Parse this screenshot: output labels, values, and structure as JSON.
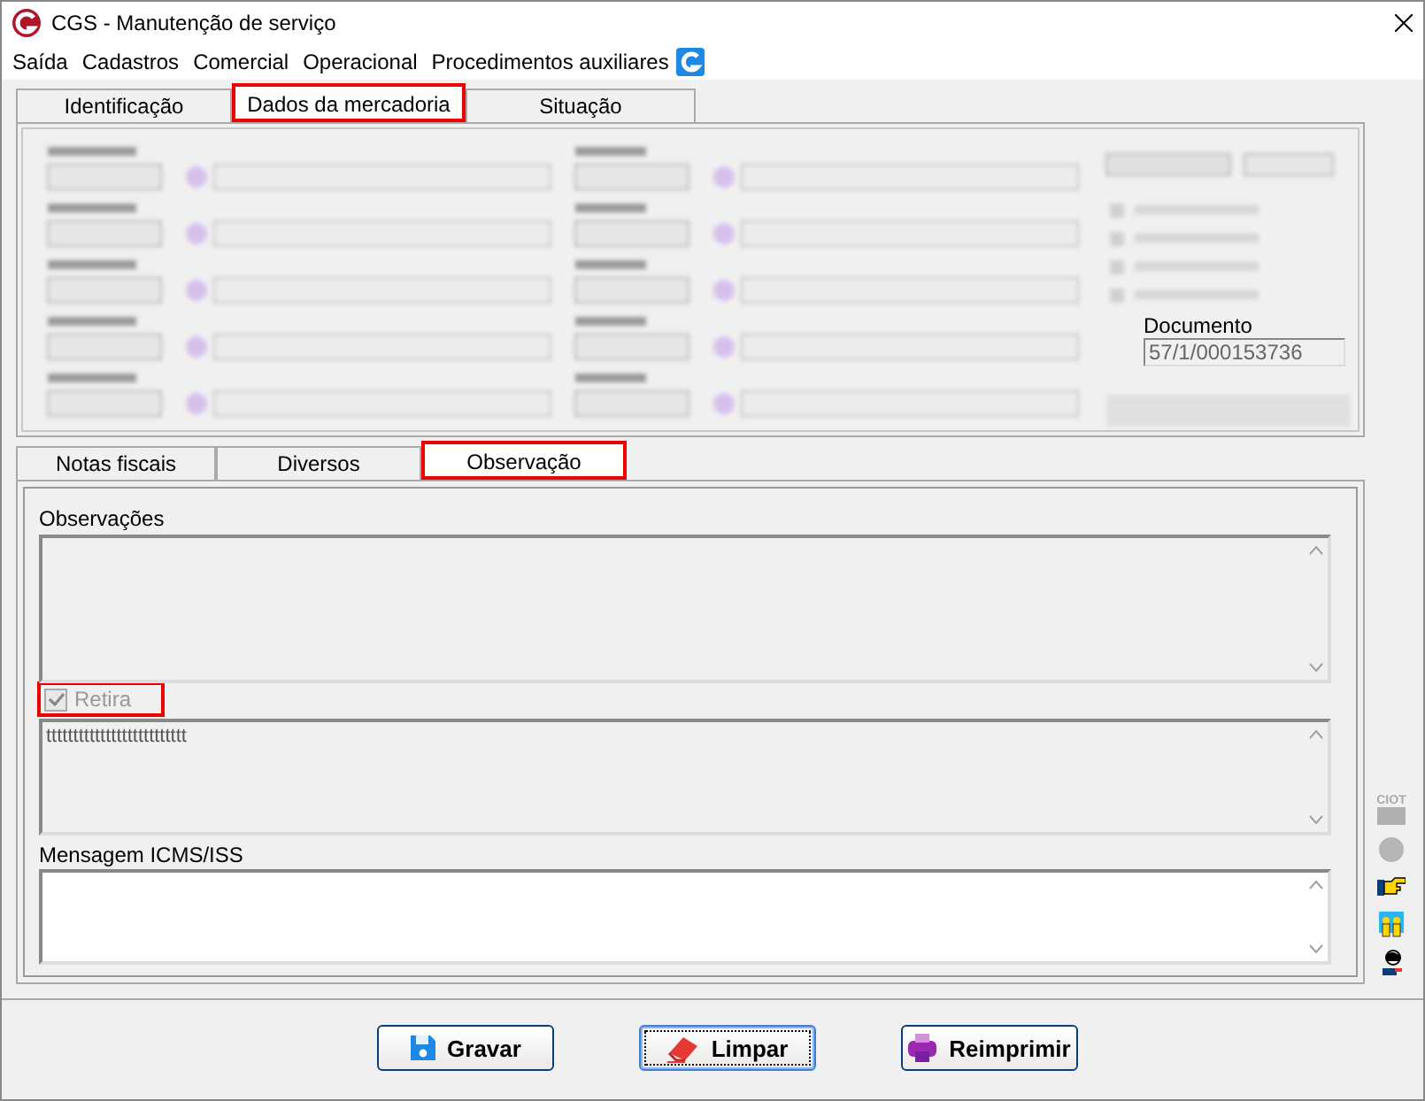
{
  "window": {
    "title": "CGS - Manutenção de serviço"
  },
  "menu": [
    "Saída",
    "Cadastros",
    "Comercial",
    "Operacional",
    "Procedimentos auxiliares"
  ],
  "outer_tabs": [
    {
      "label": "Identificação",
      "selected": false,
      "highlighted": false
    },
    {
      "label": "Dados da mercadoria",
      "selected": true,
      "highlighted": true
    },
    {
      "label": "Situação",
      "selected": false,
      "highlighted": false
    }
  ],
  "top_panel": {
    "documento": {
      "label": "Documento",
      "value": "57/1/000153736"
    }
  },
  "inner_tabs": [
    {
      "label": "Notas fiscais",
      "selected": false,
      "highlighted": false
    },
    {
      "label": "Diversos",
      "selected": false,
      "highlighted": false
    },
    {
      "label": "Observação",
      "selected": true,
      "highlighted": true
    }
  ],
  "observacao": {
    "observacoes_label": "Observações",
    "retira": {
      "label": "Retira",
      "checked": true,
      "disabled": true,
      "highlighted": true
    },
    "retira_text": "tttttttttttttttttttttttttt",
    "mensagem_label": "Mensagem ICMS/ISS"
  },
  "side_icons": [
    {
      "kind": "ciot",
      "label": "CIOT"
    },
    {
      "kind": "circle"
    },
    {
      "kind": "hand"
    },
    {
      "kind": "people"
    },
    {
      "kind": "person"
    }
  ],
  "buttons": [
    {
      "label": "Gravar",
      "kind": "save",
      "focused": false
    },
    {
      "label": "Limpar",
      "kind": "erase",
      "focused": true
    },
    {
      "label": "Reimprimir",
      "kind": "print",
      "focused": false
    }
  ]
}
